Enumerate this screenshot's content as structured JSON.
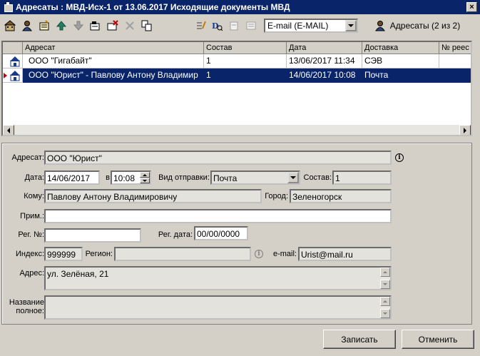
{
  "window": {
    "title": "Адресаты : МВД-Исх-1 от 13.06.2017 Исходящие документы МВД",
    "close_label": "×"
  },
  "toolbar": {
    "delivery_select": "E-mail (E-MAIL)",
    "addressees_button": "Адресаты (2 из 2)"
  },
  "grid": {
    "columns": [
      "Адресат",
      "Состав",
      "Дата",
      "Доставка",
      "№ реес"
    ],
    "rows": [
      {
        "addressee": "ООО \"Гигабайт\"",
        "composition": "1",
        "date": "13/06/2017 11:34",
        "delivery": "СЭВ",
        "registry": "",
        "selected": false
      },
      {
        "addressee": "ООО \"Юрист\" - Павлову Антону Владимир",
        "composition": "1",
        "date": "14/06/2017 10:08",
        "delivery": "Почта",
        "registry": "",
        "selected": true
      }
    ]
  },
  "form": {
    "addressee_label": "Адресат:",
    "addressee_value": "ООО \"Юрист\"",
    "date_label": "Дата:",
    "date_value": "14/06/2017",
    "time_label": "в",
    "time_value": "10:08",
    "send_type_label": "Вид отправки:",
    "send_type_value": "Почта",
    "composition_label": "Состав:",
    "composition_value": "1",
    "to_label": "Кому:",
    "to_value": "Павлову Антону Владимировичу",
    "city_label": "Город:",
    "city_value": "Зеленогорск",
    "note_label": "Прим.:",
    "note_value": "",
    "reg_no_label": "Рег. №:",
    "reg_no_value": "",
    "reg_date_label": "Рег. дата:",
    "reg_date_value": "00/00/0000",
    "index_label": "Индекс:",
    "index_value": "999999",
    "region_label": "Регион:",
    "region_value": "",
    "email_label": "e-mail:",
    "email_value": "Urist@mail.ru",
    "address_label": "Адрес:",
    "address_value": "ул. Зелёная, 21",
    "fullname_label_1": "Название",
    "fullname_label_2": "полное:",
    "fullname_value": ""
  },
  "buttons": {
    "save": "Записать",
    "cancel": "Отменить"
  }
}
